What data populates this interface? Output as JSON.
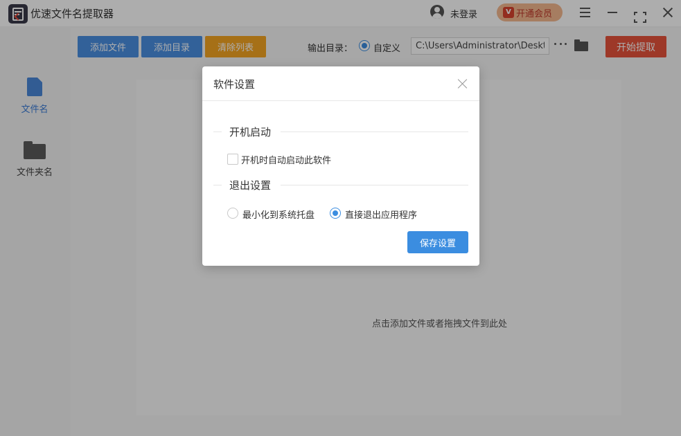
{
  "app": {
    "title": "优速文件名提取器"
  },
  "header": {
    "login_text": "未登录",
    "vip_label": "开通会员",
    "vip_badge": "V"
  },
  "sidebar": {
    "items": [
      {
        "label": "文件名",
        "icon": "file-icon",
        "active": true
      },
      {
        "label": "文件夹名",
        "icon": "folder-icon",
        "active": false
      }
    ]
  },
  "toolbar": {
    "add_file": "添加文件",
    "add_dir": "添加目录",
    "clear_list": "清除列表",
    "output_label": "输出目录：",
    "custom_label": "自定义",
    "path_value": "C:\\Users\\Administrator\\Desktop",
    "start": "开始提取"
  },
  "main": {
    "drop_hint": "点击添加文件或者拖拽文件到此处"
  },
  "dialog": {
    "title": "软件设置",
    "startup_section": "开机启动",
    "startup_checkbox": "开机时自动启动此软件",
    "startup_checked": false,
    "exit_section": "退出设置",
    "exit_options": [
      {
        "label": "最小化到系统托盘",
        "selected": false
      },
      {
        "label": "直接退出应用程序",
        "selected": true
      }
    ],
    "save": "保存设置"
  },
  "colors": {
    "accent_blue": "#3b8de0",
    "btn_blue": "#4a90e2",
    "btn_orange": "#f5a623",
    "start_red": "#e8533b",
    "vip_bg": "#f5b98f"
  }
}
